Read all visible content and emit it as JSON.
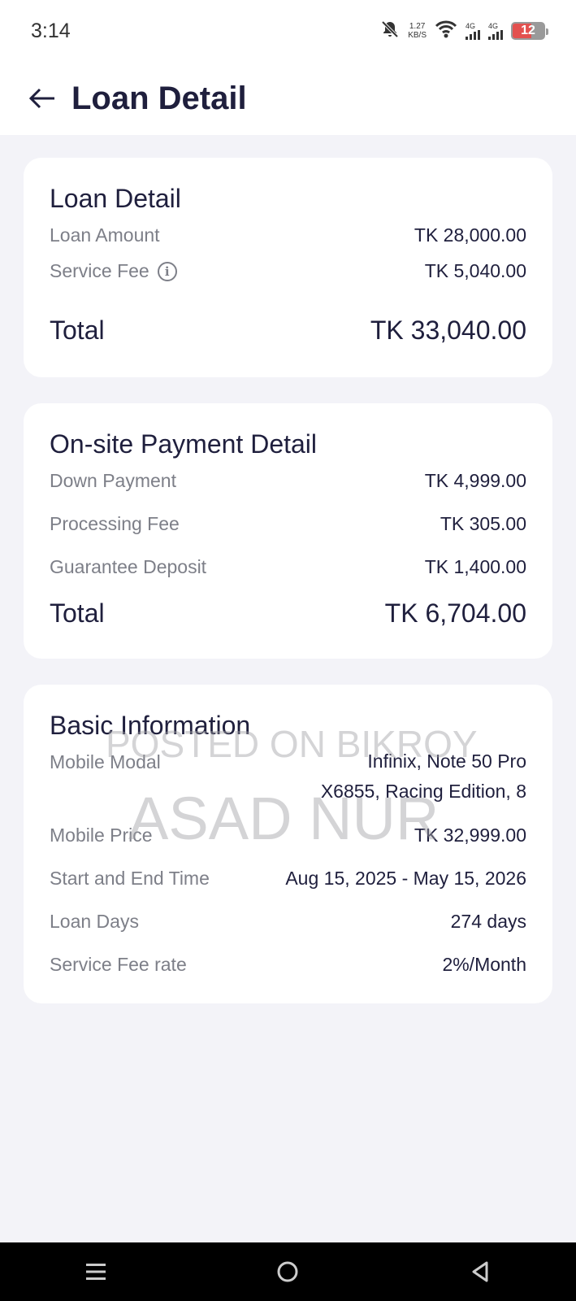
{
  "status": {
    "time": "3:14",
    "net_speed_value": "1.27",
    "net_speed_unit": "KB/S",
    "signal1": "4G",
    "signal2": "4G",
    "battery": "12"
  },
  "header": {
    "title": "Loan Detail"
  },
  "loan_card": {
    "title": "Loan Detail",
    "rows": [
      {
        "label": "Loan Amount",
        "value": "TK 28,000.00"
      },
      {
        "label": "Service Fee",
        "value": "TK 5,040.00"
      }
    ],
    "total_label": "Total",
    "total_value": "TK 33,040.00"
  },
  "payment_card": {
    "title": "On-site Payment Detail",
    "rows": [
      {
        "label": "Down Payment",
        "value": "TK 4,999.00"
      },
      {
        "label": "Processing Fee",
        "value": "TK 305.00"
      },
      {
        "label": "Guarantee Deposit",
        "value": "TK 1,400.00"
      }
    ],
    "total_label": "Total",
    "total_value": "TK 6,704.00"
  },
  "basic_card": {
    "title": "Basic Information",
    "mobile_modal_label": "Mobile Modal",
    "mobile_modal_line1": "Infinix, Note 50 Pro",
    "mobile_modal_line2": "X6855, Racing Edition, 8",
    "rows": [
      {
        "label": "Mobile Price",
        "value": "TK 32,999.00"
      },
      {
        "label": "Start and End Time",
        "value": "Aug 15, 2025 - May 15, 2026"
      },
      {
        "label": "Loan Days",
        "value": "274 days"
      },
      {
        "label": "Service Fee rate",
        "value": "2%/Month"
      }
    ]
  },
  "watermark": {
    "line1": "POSTED ON BIKROY",
    "line2": "ASAD NUR"
  },
  "icons": {
    "back": "arrow-left-icon",
    "info": "info-icon",
    "menu": "menu-icon",
    "home": "home-icon",
    "back_nav": "triangle-back-icon"
  }
}
